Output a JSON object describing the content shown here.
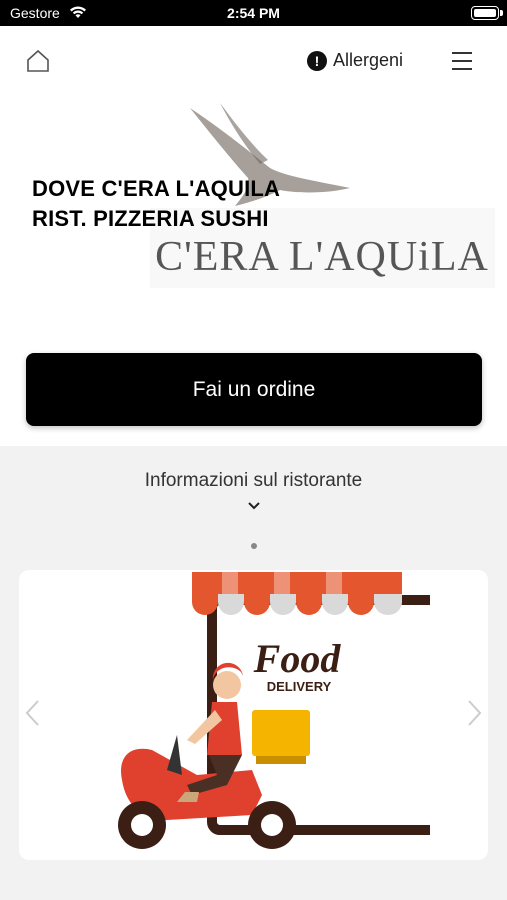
{
  "status_bar": {
    "carrier": "Gestore",
    "time": "2:54 PM"
  },
  "nav": {
    "allergens_label": "Allergeni",
    "allergens_icon_glyph": "!",
    "home_icon": "home-icon",
    "menu_icon": "hamburger-menu-icon"
  },
  "hero": {
    "title_line1": "DOVE C'ERA L'AQUILA",
    "title_line2": "RIST. PIZZERIA SUSHI",
    "logo_text": "C'ERA L'AQUiLA"
  },
  "order_button": {
    "label": "Fai un ordine"
  },
  "info": {
    "title": "Informazioni sul ristorante"
  },
  "carousel": {
    "slides": [
      {
        "image_text_1": "Food",
        "image_text_2": "DELIVERY"
      }
    ]
  },
  "colors": {
    "accent_dark": "#000000",
    "awning_red": "#e4572e",
    "section_bg": "#f2f2f2"
  }
}
